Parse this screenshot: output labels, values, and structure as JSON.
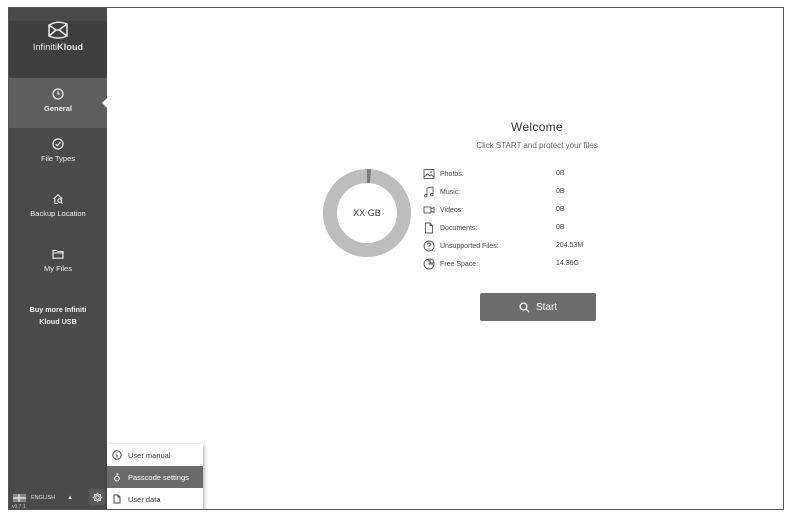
{
  "brand": {
    "name_light": "Infiniti",
    "name_bold": "Kloud"
  },
  "nav": {
    "items": [
      {
        "id": "general",
        "label": "General",
        "icon": "clock-icon",
        "active": true
      },
      {
        "id": "file-types",
        "label": "File Types",
        "icon": "check-circle-icon",
        "active": false
      },
      {
        "id": "backup-location",
        "label": "Backup Location",
        "icon": "home-search-icon",
        "active": false
      },
      {
        "id": "my-files",
        "label": "My Files",
        "icon": "folder-icon",
        "active": false
      }
    ],
    "buy_more_line1": "Buy more Infiniti",
    "buy_more_line2": "Kloud USB"
  },
  "footer": {
    "language": "ENGLISH",
    "version": "v0.7.1"
  },
  "popup_menu": {
    "items": [
      {
        "label": "User manual",
        "icon": "info-icon"
      },
      {
        "label": "Passcode settings",
        "icon": "key-icon",
        "selected": true
      },
      {
        "label": "User data",
        "icon": "document-icon"
      }
    ]
  },
  "main": {
    "title": "Welcome",
    "subtitle": "Click START and protect your files",
    "capacity_label": "XX GB",
    "used_fraction": 0.015,
    "stats": [
      {
        "label": "Photos:",
        "value": "0B",
        "icon": "image-icon"
      },
      {
        "label": "Music:",
        "value": "0B",
        "icon": "music-note-icon"
      },
      {
        "label": "Videos:",
        "value": "0B",
        "icon": "video-icon"
      },
      {
        "label": "Documents:",
        "value": "0B",
        "icon": "document-icon"
      },
      {
        "label": "Unsupported Files:",
        "value": "204.53M",
        "icon": "question-circle-icon"
      },
      {
        "label": "Free Space:",
        "value": "14.36G",
        "icon": "pie-icon"
      }
    ],
    "start_label": "Start"
  },
  "colors": {
    "sidebar": "#4a4a4a",
    "active_item": "#5e5e5e",
    "button": "#6d6d6d",
    "donut": "#bdbdbd"
  }
}
